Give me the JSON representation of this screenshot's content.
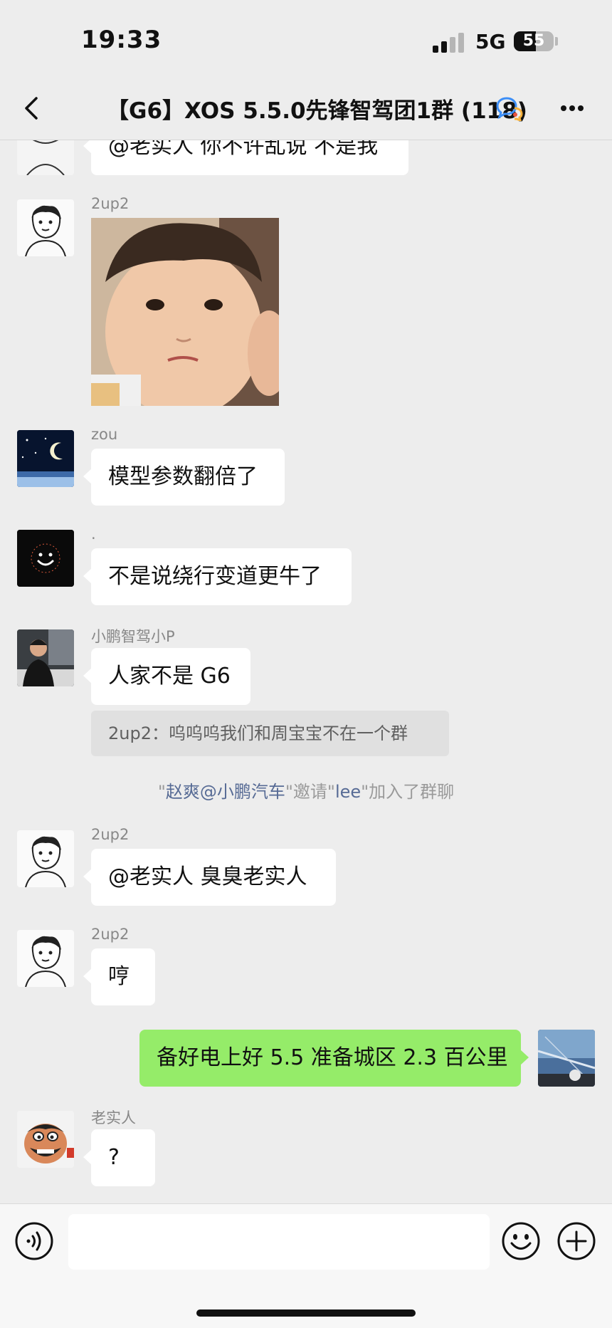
{
  "status_bar": {
    "time": "19:33",
    "network": "5G",
    "battery": "55",
    "battery_level": 0.55
  },
  "header": {
    "title": "【G6】XOS 5.5.0先锋智驾团1群 (118)"
  },
  "messages": {
    "m0": {
      "text": "@老实人 你不许乱说 不是我"
    },
    "m1": {
      "sender": "2up2"
    },
    "m2": {
      "sender": "zou",
      "text": "模型参数翻倍了"
    },
    "m3": {
      "sender": ".",
      "text": "不是说绕行变道更牛了"
    },
    "m4": {
      "sender": "小鹏智驾小P",
      "text": "人家不是 G6",
      "quote": "2up2：呜呜呜我们和周宝宝不在一个群"
    },
    "system": {
      "q1": "\"",
      "inviter": "赵爽@小鹏汽车",
      "mid": "\"邀请\"",
      "invitee": "lee",
      "end": "\"加入了群聊"
    },
    "m5": {
      "sender": "2up2",
      "text": "@老实人 臭臭老实人"
    },
    "m6": {
      "sender": "2up2",
      "text": "哼"
    },
    "m7": {
      "text": "备好电上好 5.5 准备城区 2.3 百公里"
    },
    "m8": {
      "sender": "老实人",
      "text": "?"
    }
  },
  "icons": {
    "back": "chevron-left-icon",
    "group_chat": "chat-bubbles-icon",
    "more": "more-dots-icon",
    "voice": "voice-icon",
    "emoji": "emoji-icon",
    "plus": "plus-icon"
  },
  "colors": {
    "background": "#ededed",
    "bubble_self": "#95ec69",
    "bubble_other": "#ffffff",
    "link": "#576b95"
  }
}
